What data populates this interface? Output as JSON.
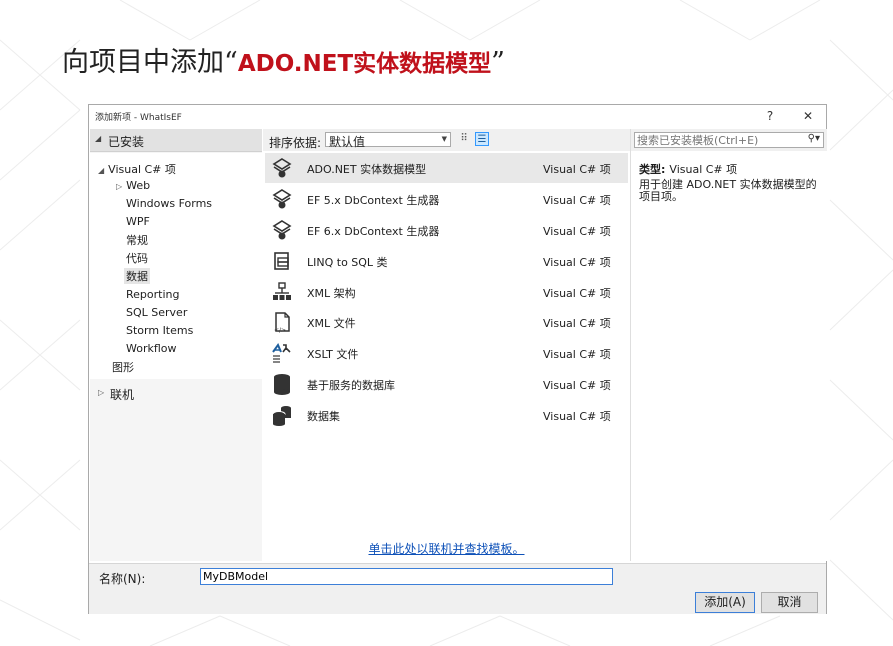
{
  "slide": {
    "title_prefix": "向项目中添加",
    "open_quote": "“",
    "title_highlight": "ADO.NET实体数据模型",
    "close_quote": "”"
  },
  "dialog": {
    "title": "添加新项 - WhatIsEF",
    "help_label": "?",
    "close_label": "✕",
    "installed_header": "已安装",
    "tree": [
      {
        "label": "Visual C# 项",
        "expander": "◢"
      },
      {
        "label": "Web",
        "expander": "▷"
      },
      {
        "label": "Windows Forms"
      },
      {
        "label": "WPF"
      },
      {
        "label": "常规"
      },
      {
        "label": "代码"
      },
      {
        "label": "数据",
        "selected": true
      },
      {
        "label": "Reporting"
      },
      {
        "label": "SQL Server"
      },
      {
        "label": "Storm Items"
      },
      {
        "label": "Workflow"
      },
      {
        "label": "图形"
      }
    ],
    "online_label": "联机",
    "sort_label": "排序依据:",
    "sort_value": "默认值",
    "templates": [
      {
        "name": "ADO.NET 实体数据模型",
        "type": "Visual C# 项",
        "icon": "ado-net-model-icon"
      },
      {
        "name": "EF 5.x DbContext 生成器",
        "type": "Visual C# 项",
        "icon": "ef-generator-icon"
      },
      {
        "name": "EF 6.x DbContext 生成器",
        "type": "Visual C# 项",
        "icon": "ef-generator-icon"
      },
      {
        "name": "LINQ to SQL 类",
        "type": "Visual C# 项",
        "icon": "linq-to-sql-icon"
      },
      {
        "name": "XML 架构",
        "type": "Visual C# 项",
        "icon": "xml-schema-icon"
      },
      {
        "name": "XML 文件",
        "type": "Visual C# 项",
        "icon": "xml-file-icon"
      },
      {
        "name": "XSLT 文件",
        "type": "Visual C# 项",
        "icon": "xslt-file-icon"
      },
      {
        "name": "基于服务的数据库",
        "type": "Visual C# 项",
        "icon": "database-icon"
      },
      {
        "name": "数据集",
        "type": "Visual C# 项",
        "icon": "dataset-icon"
      }
    ],
    "online_link": "单击此处以联机并查找模板。",
    "search_placeholder": "搜索已安装模板(Ctrl+E)",
    "detail_type_label": "类型:",
    "detail_type_value": "Visual C# 项",
    "detail_description": "用于创建 ADO.NET 实体数据模型的项目项。",
    "name_label": "名称(N):",
    "name_value": "MyDBModel",
    "add_button": "添加(A)",
    "cancel_button": "取消"
  },
  "colors": {
    "title_highlight": "#c0111b",
    "link": "#0e51b8",
    "selection": "#e8e8e8"
  }
}
